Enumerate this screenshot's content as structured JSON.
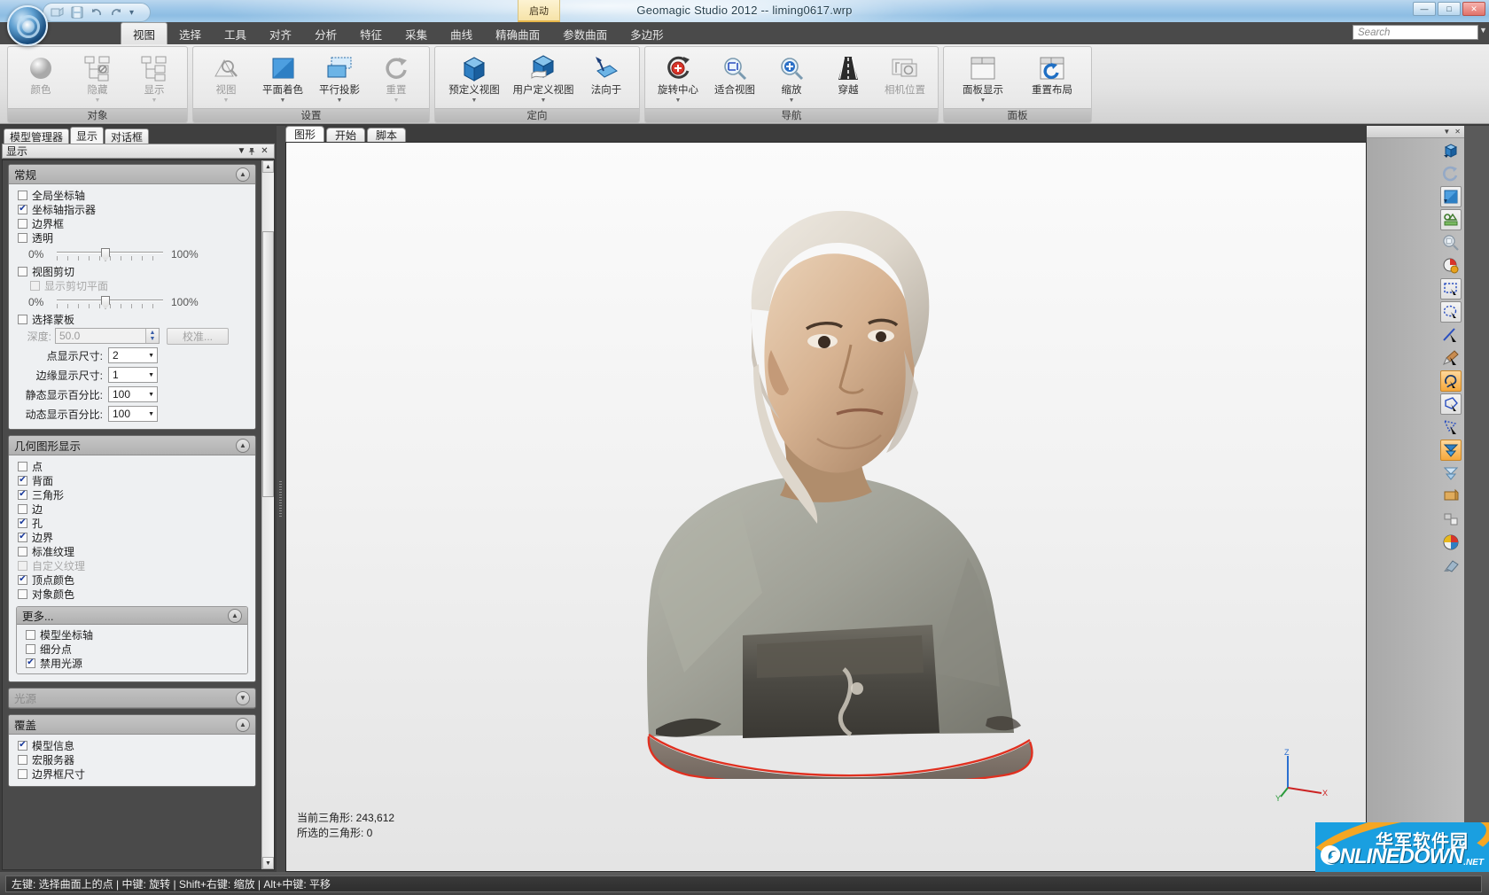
{
  "window": {
    "title": "Geomagic Studio 2012 -- liming0617.wrp",
    "start_badge": "启动",
    "minimize": "—",
    "maximize": "□",
    "close": "✕",
    "qat": {
      "open": "open-icon",
      "save": "save-icon",
      "undo": "undo-icon",
      "redo": "redo-icon",
      "more": "▾"
    }
  },
  "search": {
    "placeholder": "Search",
    "value": ""
  },
  "ribbon_tabs": [
    {
      "label": "视图",
      "active": true
    },
    {
      "label": "选择",
      "active": false
    },
    {
      "label": "工具",
      "active": false
    },
    {
      "label": "对齐",
      "active": false
    },
    {
      "label": "分析",
      "active": false
    },
    {
      "label": "特征",
      "active": false
    },
    {
      "label": "采集",
      "active": false
    },
    {
      "label": "曲线",
      "active": false
    },
    {
      "label": "精确曲面",
      "active": false
    },
    {
      "label": "参数曲面",
      "active": false
    },
    {
      "label": "多边形",
      "active": false
    }
  ],
  "ribbon_groups": [
    {
      "title": "对象",
      "items": [
        {
          "label": "颜色",
          "icon": "sphere-color-icon",
          "disabled": true,
          "dropdown": false
        },
        {
          "label": "隐藏",
          "icon": "hide-object-icon",
          "disabled": true,
          "dropdown": true
        },
        {
          "label": "显示",
          "icon": "show-object-icon",
          "disabled": true,
          "dropdown": true
        }
      ]
    },
    {
      "title": "设置",
      "items": [
        {
          "label": "视图",
          "icon": "view-icon",
          "disabled": true,
          "dropdown": true
        },
        {
          "label": "平面着色",
          "icon": "flat-shade-icon",
          "disabled": false,
          "dropdown": true
        },
        {
          "label": "平行投影",
          "icon": "parallel-projection-icon",
          "disabled": false,
          "dropdown": true
        },
        {
          "label": "重置",
          "icon": "reset-icon",
          "disabled": true,
          "dropdown": true
        }
      ]
    },
    {
      "title": "定向",
      "items": [
        {
          "label": "预定义视图",
          "icon": "predefined-view-cube-icon",
          "disabled": false,
          "dropdown": true
        },
        {
          "label": "用户定义视图",
          "icon": "user-defined-view-icon",
          "disabled": false,
          "dropdown": true
        },
        {
          "label": "法向于",
          "icon": "normal-to-icon",
          "disabled": false,
          "dropdown": false
        }
      ]
    },
    {
      "title": "导航",
      "items": [
        {
          "label": "旋转中心",
          "icon": "rotation-center-icon",
          "disabled": false,
          "dropdown": true
        },
        {
          "label": "适合视图",
          "icon": "fit-view-icon",
          "disabled": false,
          "dropdown": false
        },
        {
          "label": "缩放",
          "icon": "zoom-icon",
          "disabled": false,
          "dropdown": true
        },
        {
          "label": "穿越",
          "icon": "fly-through-icon",
          "disabled": false,
          "dropdown": false
        },
        {
          "label": "相机位置",
          "icon": "camera-position-icon",
          "disabled": true,
          "dropdown": false
        }
      ]
    },
    {
      "title": "面板",
      "items": [
        {
          "label": "面板显示",
          "icon": "panel-display-icon",
          "disabled": false,
          "dropdown": true
        },
        {
          "label": "重置布局",
          "icon": "reset-layout-icon",
          "disabled": false,
          "dropdown": false
        }
      ]
    }
  ],
  "left_panel": {
    "tabs": [
      {
        "label": "模型管理器",
        "active": false
      },
      {
        "label": "显示",
        "active": true
      },
      {
        "label": "对话框",
        "active": false
      }
    ],
    "header": {
      "title": "显示",
      "menu_icon": "▼",
      "pin_icon": "pin-icon",
      "close_icon": "✕"
    },
    "sections": [
      {
        "title": "常规",
        "collapsed": false,
        "checkboxes": [
          {
            "label": "全局坐标轴",
            "checked": false,
            "enabled": true
          },
          {
            "label": "坐标轴指示器",
            "checked": true,
            "enabled": true
          },
          {
            "label": "边界框",
            "checked": false,
            "enabled": true
          },
          {
            "label": "透明",
            "checked": false,
            "enabled": true
          }
        ],
        "slider1": {
          "min_label": "0%",
          "max_label": "100%",
          "value": 50
        },
        "checkbox_clip": {
          "label": "视图剪切",
          "checked": false,
          "enabled": true
        },
        "checkbox_clip_plane": {
          "label": "显示剪切平面",
          "checked": false,
          "enabled": false
        },
        "slider2": {
          "min_label": "0%",
          "max_label": "100%",
          "value": 50
        },
        "checkbox_mask": {
          "label": "选择蒙板",
          "checked": false,
          "enabled": true
        },
        "depth": {
          "label": "深度:",
          "value": "50.0"
        },
        "calibrate_button": "校准...",
        "fields": [
          {
            "label": "点显示尺寸:",
            "value": "2"
          },
          {
            "label": "边缘显示尺寸:",
            "value": "1"
          },
          {
            "label": "静态显示百分比:",
            "value": "100"
          },
          {
            "label": "动态显示百分比:",
            "value": "100"
          }
        ]
      },
      {
        "title": "几何图形显示",
        "collapsed": false,
        "checkboxes": [
          {
            "label": "点",
            "checked": false,
            "enabled": true
          },
          {
            "label": "背面",
            "checked": true,
            "enabled": true
          },
          {
            "label": "三角形",
            "checked": true,
            "enabled": true
          },
          {
            "label": "边",
            "checked": false,
            "enabled": true
          },
          {
            "label": "孔",
            "checked": true,
            "enabled": true
          },
          {
            "label": "边界",
            "checked": true,
            "enabled": true
          },
          {
            "label": "标准纹理",
            "checked": false,
            "enabled": true
          },
          {
            "label": "自定义纹理",
            "checked": false,
            "enabled": false
          },
          {
            "label": "顶点颜色",
            "checked": true,
            "enabled": true
          },
          {
            "label": "对象颜色",
            "checked": false,
            "enabled": true
          }
        ],
        "more": {
          "title": "更多...",
          "checkboxes": [
            {
              "label": "模型坐标轴",
              "checked": false,
              "enabled": true
            },
            {
              "label": "细分点",
              "checked": false,
              "enabled": true
            },
            {
              "label": "禁用光源",
              "checked": true,
              "enabled": true
            }
          ]
        }
      },
      {
        "title": "光源",
        "collapsed": true,
        "disabled": true
      },
      {
        "title": "覆盖",
        "collapsed": false,
        "checkboxes": [
          {
            "label": "模型信息",
            "checked": true,
            "enabled": true
          },
          {
            "label": "宏服务器",
            "checked": false,
            "enabled": true
          },
          {
            "label": "边界框尺寸",
            "checked": false,
            "enabled": true
          }
        ]
      }
    ]
  },
  "viewport": {
    "tabs": [
      {
        "label": "图形",
        "active": true
      },
      {
        "label": "开始",
        "active": false
      },
      {
        "label": "脚本",
        "active": false
      }
    ],
    "info": {
      "current_triangles": "当前三角形: 243,612",
      "selected_triangles": "所选的三角形: 0"
    },
    "axes": {
      "x": "X",
      "y": "Y",
      "z": "Z"
    },
    "model_alt": "3D scanned bust of a man wearing a cap and grey t-shirt"
  },
  "right_toolbar": {
    "buttons": [
      {
        "icon": "view-cube-icon",
        "state": "normal"
      },
      {
        "icon": "rotate-reset-icon",
        "state": "disabled"
      },
      {
        "icon": "shade-mode-icon",
        "state": "framed"
      },
      {
        "icon": "section-plane-icon",
        "state": "normal"
      },
      {
        "icon": "zoom-fit-icon",
        "state": "normal"
      },
      {
        "icon": "rotation-center-icon",
        "state": "normal"
      },
      {
        "icon": "rectangle-select-icon",
        "state": "framed"
      },
      {
        "icon": "ellipse-select-icon",
        "state": "framed"
      },
      {
        "icon": "line-select-icon",
        "state": "normal"
      },
      {
        "icon": "paint-select-icon",
        "state": "normal"
      },
      {
        "icon": "lasso-select-icon",
        "state": "selected"
      },
      {
        "icon": "polygon-select-icon",
        "state": "framed"
      },
      {
        "icon": "freeform-select-icon",
        "state": "normal"
      },
      {
        "icon": "select-through-icon",
        "state": "selected"
      },
      {
        "icon": "select-visible-icon",
        "state": "normal"
      },
      {
        "icon": "select-back-icon",
        "state": "normal"
      },
      {
        "icon": "select-components-icon",
        "state": "normal"
      },
      {
        "icon": "globe-color-icon",
        "state": "normal"
      },
      {
        "icon": "eraser-icon",
        "state": "disabled"
      }
    ]
  },
  "statusbar": {
    "text": "左键: 选择曲面上的点 | 中键: 旋转 | Shift+右键: 缩放 | Alt+中键: 平移"
  },
  "watermark": {
    "cn": "华军软件园",
    "en": "ONLINEDOWN",
    "net": ".NET"
  },
  "colors": {
    "accent_blue": "#2f6fb5",
    "highlight_orange": "#f6a83c",
    "boundary_red": "#e03020",
    "titlebar_blue": "#9cc6e8"
  }
}
